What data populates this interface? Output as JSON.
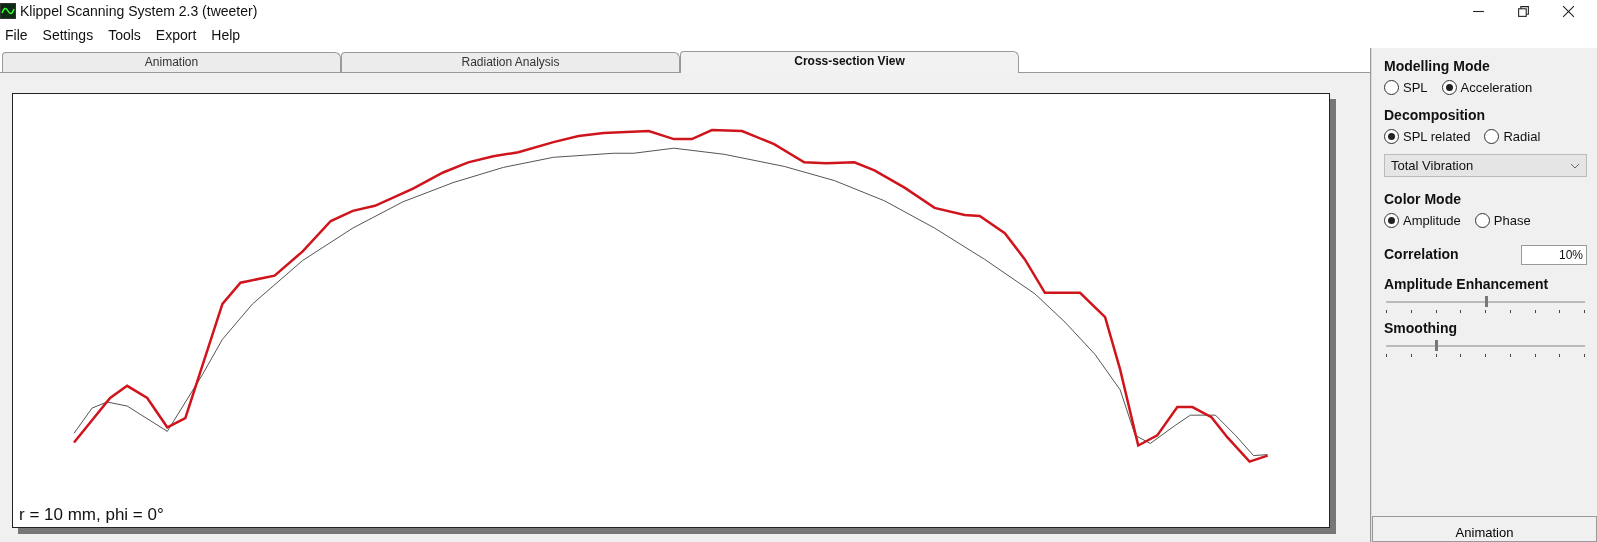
{
  "window": {
    "title": "Klippel Scanning System 2.3 (tweeter)"
  },
  "menu": [
    "File",
    "Settings",
    "Tools",
    "Export",
    "Help"
  ],
  "tabs": [
    {
      "label": "Animation",
      "selected": false
    },
    {
      "label": "Radiation Analysis",
      "selected": false
    },
    {
      "label": "Cross-section View",
      "selected": true
    }
  ],
  "plot": {
    "caption": "r = 10 mm, phi = 0°"
  },
  "panel": {
    "groups": [
      {
        "kind": "radio",
        "title": "Modelling Mode",
        "options": [
          {
            "label": "SPL",
            "selected": false
          },
          {
            "label": "Acceleration",
            "selected": true
          }
        ]
      },
      {
        "kind": "radio",
        "title": "Decomposition",
        "options": [
          {
            "label": "SPL related",
            "selected": true
          },
          {
            "label": "Radial",
            "selected": false
          }
        ]
      },
      {
        "kind": "dropdown",
        "value": "Total Vibration"
      },
      {
        "kind": "radio",
        "title": "Color Mode",
        "options": [
          {
            "label": "Amplitude",
            "selected": true
          },
          {
            "label": "Phase",
            "selected": false
          }
        ]
      },
      {
        "kind": "field",
        "title": "Correlation",
        "value": "10%"
      },
      {
        "kind": "slider",
        "title": "Amplitude Enhancement",
        "level": 0.5
      },
      {
        "kind": "slider",
        "title": "Smoothing",
        "level": 0.25
      }
    ],
    "button": "Animation"
  }
}
